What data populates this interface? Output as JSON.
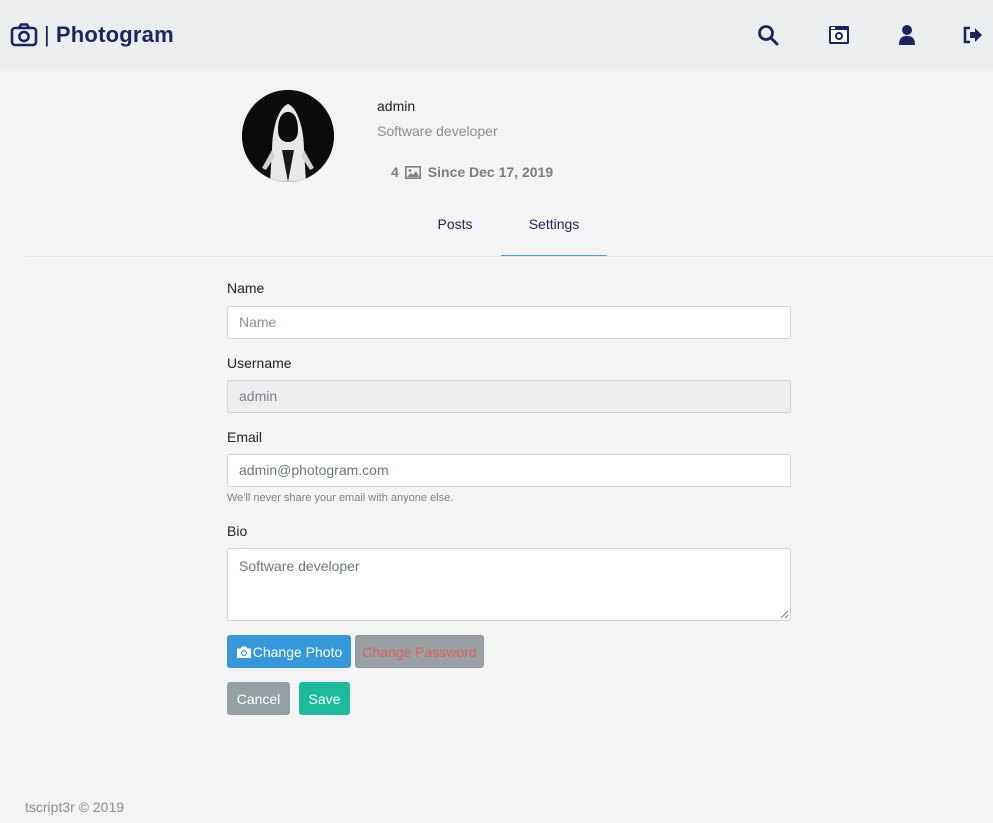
{
  "navbar": {
    "brand_separator": "|",
    "brand_name": "Photogram",
    "icons": [
      "search-icon",
      "camera-upload-icon",
      "user-icon",
      "sign-out-icon"
    ],
    "brand_color": "#1b2660"
  },
  "profile": {
    "username": "admin",
    "bio": "Software developer",
    "post_count": "4",
    "since": "Since Dec 17, 2019"
  },
  "tabs": {
    "posts": "Posts",
    "settings": "Settings",
    "active": "Settings",
    "accent": "#3aa8de"
  },
  "form": {
    "name_label": "Name",
    "name_placeholder": "Name",
    "username_label": "Username",
    "username_value": "admin",
    "email_label": "Email",
    "email_value": "admin@photogram.com",
    "email_help": "We'll never share your email with anyone else.",
    "bio_label": "Bio",
    "bio_value": "Software developer"
  },
  "buttons": {
    "change_photo": "Change Photo",
    "change_password": "Change Password",
    "cancel": "Cancel",
    "save": "Save"
  },
  "footer": {
    "text": "tscript3r © 2019"
  }
}
